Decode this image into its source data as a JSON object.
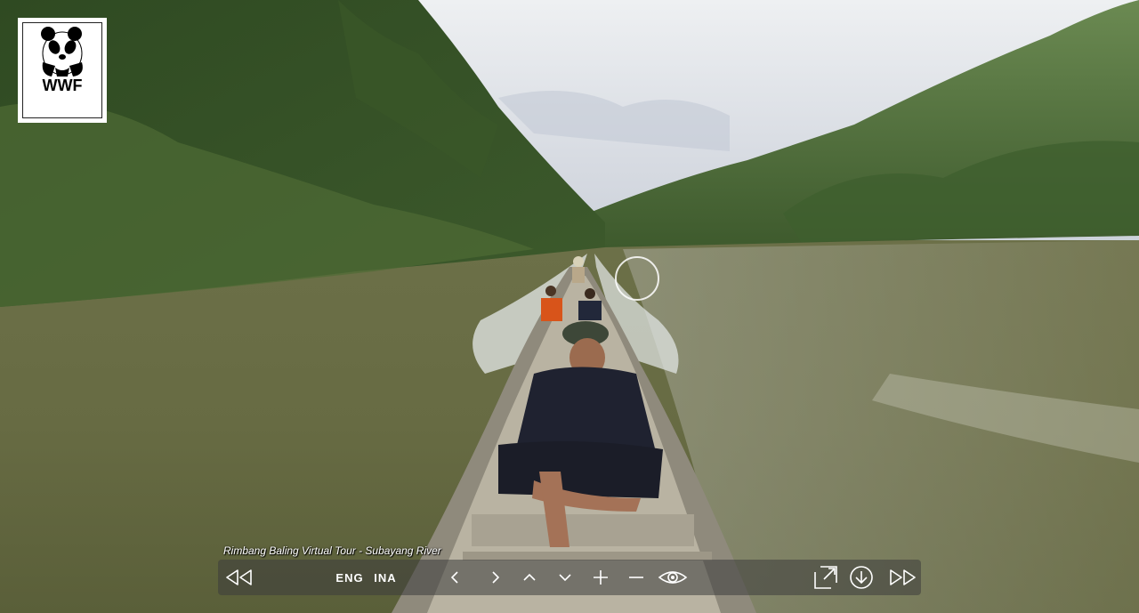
{
  "brand": {
    "logo_text": "WWF",
    "logo_icon": "panda-icon"
  },
  "tour": {
    "caption": "Rimbang Baling Virtual Tour - Subayang River"
  },
  "toolbar": {
    "languages": [
      "ENG",
      "INA"
    ],
    "icons": {
      "previous_panorama": "double-left-triangle-icon",
      "pan_left": "chevron-left-icon",
      "pan_right": "chevron-right-icon",
      "tilt_up": "chevron-up-icon",
      "tilt_down": "chevron-down-icon",
      "zoom_in": "plus-icon",
      "zoom_out": "minus-icon",
      "view_mode": "eye-icon",
      "fullscreen": "fullscreen-icon",
      "download": "download-icon",
      "next_panorama": "double-right-triangle-icon"
    }
  },
  "colors": {
    "toolbar_bg": "#3c3c3c",
    "icon": "#ffffff"
  }
}
